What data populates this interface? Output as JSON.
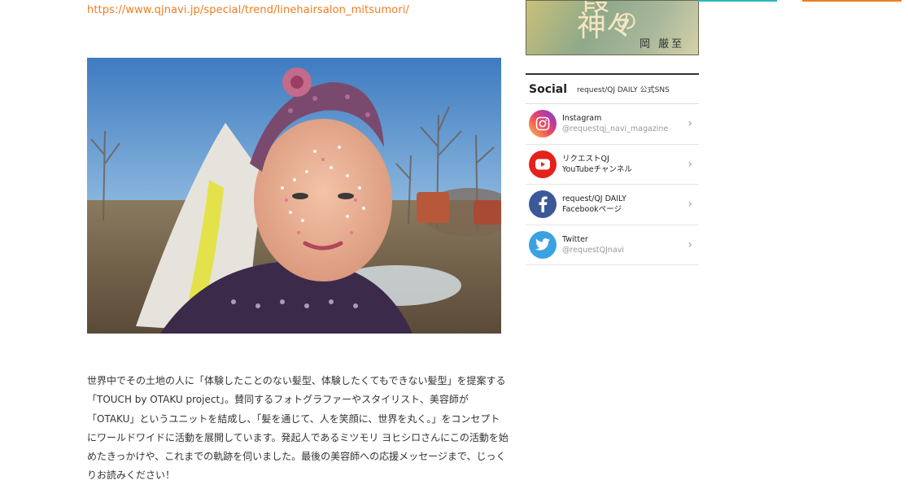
{
  "article": {
    "link": "https://www.qjnavi.jp/special/trend/linehairsalon_mitsumori/",
    "paragraph_lines": [
      "世界中でその土地の人に「体験したことのない髪型、体験したくてもできない髪型」を提案する",
      "「TOUCH by OTAKU project」。賛同するフォトグラファーやスタイリスト、美容師が",
      "「OTAKU」というユニットを結成し、「髪を通じて、人を笑顔に、世界を丸く。」をコンセプト",
      "にワールドワイドに活動を展開しています。発起人であるミツモリ ヨヒシロさんにこの活動を始",
      "めたきっかけや、これまでの軌跡を伺いました。最後の美容師への応援メッセージまで、じっく",
      "りお読みください！"
    ]
  },
  "banner": {
    "kanji_top": "葭",
    "kanji_main": "神々",
    "no": "の",
    "author": "岡 厳至"
  },
  "social": {
    "title": "Social",
    "subtitle": "request/QJ DAILY 公式SNS",
    "items": [
      {
        "line1": "Instagram",
        "line2": "@requestqj_navi_magazine",
        "icon": "instagram-icon"
      },
      {
        "line1": "リクエストQJ",
        "line2": "YouTubeチャンネル",
        "icon": "youtube-icon"
      },
      {
        "line1": "request/QJ DAILY",
        "line2": "Facebookページ",
        "icon": "facebook-icon"
      },
      {
        "line1": "Twitter",
        "line2": "@requestQJnavi",
        "icon": "twitter-icon"
      }
    ],
    "chevron": "›"
  },
  "colors": {
    "link": "#f27c1e",
    "accent_teal": "#2bb6c4",
    "accent_orange": "#f27c1e",
    "youtube": "#e4221b",
    "facebook": "#3b5998",
    "twitter": "#3aa2e3"
  }
}
